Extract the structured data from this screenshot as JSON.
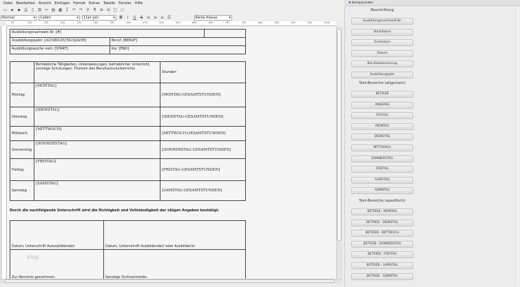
{
  "menu": [
    "Datei",
    "Bearbeiten",
    "Ansicht",
    "Einfügen",
    "Format",
    "Extras",
    "Tabelle",
    "Fenster",
    "Hilfe"
  ],
  "format": {
    "style": "Normal",
    "font": "Calibri",
    "size": "11pt (pt)",
    "class": "Keine Klasse"
  },
  "ruler": [
    "50",
    "100",
    "150",
    "200",
    "250",
    "300",
    "350",
    "400",
    "450",
    "500",
    "550",
    "600",
    "650",
    "700",
    "750",
    "800",
    "850",
    "900",
    "950",
    "1000"
  ],
  "doc": {
    "nr": "Ausbildungsnachweis Nr. [#]",
    "jahr": "Ausbildungsjahr: [AUSBILDUNGSJAHR]",
    "beruf": "Beruf: [BERUF]",
    "woche": "Ausbildungswoche vom: [START]",
    "bis": "bis: [END]",
    "col_header": "Betriebliche Tätigkeiten, Unterweisungen, betrieblicher Unterricht, sonstige Schulungen, Themen des Berufsschulunterrichts",
    "stunden": "Stunden",
    "days": [
      {
        "day": "Montag",
        "ph": "[MONTAG]",
        "h": "[MONTAG-GESAMTSTUNDEN]"
      },
      {
        "day": "Dienstag",
        "ph": "[DIENSTAG]",
        "h": "[DIENSTAG-GESAMTSTUNDEN]"
      },
      {
        "day": "Mittwoch",
        "ph": "[MITTWOCH]",
        "h": "[MITTWOCH-GESAMTSTUNDEN]"
      },
      {
        "day": "Donnerstag",
        "ph": "[DONNERSTAG]",
        "h": "[DONNERSTAG-GESAMTSTUNDEN]"
      },
      {
        "day": "Freitag",
        "ph": "[FREITAG]",
        "h": "[FREITAG-GESAMTSTUNDEN]"
      },
      {
        "day": "Samstag",
        "ph": "[SAMSTAG]",
        "h": "[SAMSTAG-GESAMTSTUNDEN]"
      }
    ],
    "statement": "Durch die nachfolgende Unterschrift wird die Richtigkeit und Vollständigkeit der obigen Angaben bestätigt.",
    "sig1": "Datum, Unterschrift Auszubildende/r",
    "sig2": "Datum, Unterschrift Ausbildende/r oder Ausbilder/in",
    "watermark": "blog",
    "kenntnis": "Zur Kenntnis genommen:",
    "sonstige": "Sonstige Sichtvermerke:"
  },
  "panel": {
    "title": "Komponenten",
    "sec1": "Beschriftung",
    "sec1_items": [
      "Ausbildungsnachweiß Nr.",
      "Startdatum",
      "Enddatum",
      "Datum",
      "Berufsbezeichnung",
      "Ausbildungsjahr"
    ],
    "sec2": "Text-Bereiche (allgemein)",
    "sec2_items": [
      "BETRIEB",
      "ANDERES",
      "SCHULE",
      "MONTAG",
      "DIENSTAG",
      "MITTWOCH",
      "DONNERSTAG",
      "FREITAG",
      "SAMSTAG",
      "SONNTAG"
    ],
    "sec3": "Text-Bereiche (spezifisch)",
    "sec3_items": [
      "BETRIEB - MONTAG",
      "BETRIEB - DIENSTAG",
      "BETRIEB - MITTWOCH",
      "BETRIEB - DONNERSTAG",
      "BETRIEB - FREITAG",
      "BETRIEB - SAMSTAG",
      "BETRIEB - SONNTAG"
    ]
  }
}
